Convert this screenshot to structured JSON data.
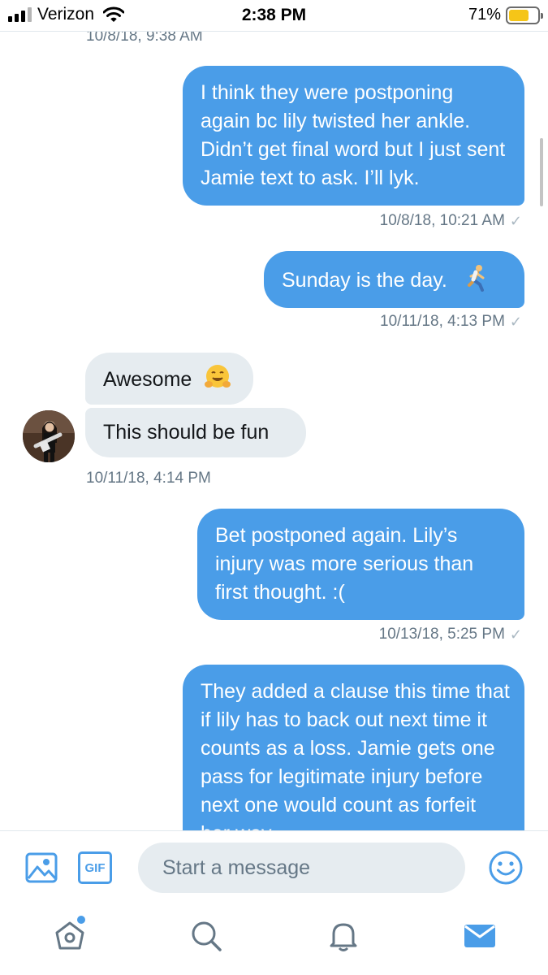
{
  "status_bar": {
    "carrier": "Verizon",
    "time": "2:38 PM",
    "battery_percent": "71%",
    "battery_level": 0.71,
    "battery_color": "#f5c518",
    "signal_bars": 3
  },
  "conversation": {
    "partial_timestamp": "10/8/18, 9:38 AM",
    "messages": [
      {
        "direction": "sent",
        "text": "I think they were postponing again bc lily twisted her ankle. Didn’t get final word but I just sent Jamie text to ask. I’ll lyk.",
        "timestamp": "10/8/18, 10:21 AM",
        "status_icon": "check-icon"
      },
      {
        "direction": "sent",
        "text": "Sunday is the day.",
        "emoji": "runner-emoji-icon",
        "timestamp": "10/11/18, 4:13 PM",
        "status_icon": "check-icon"
      },
      {
        "direction": "received",
        "text": "Awesome",
        "emoji": "hugging-face-emoji-icon"
      },
      {
        "direction": "received",
        "text": "This should be fun",
        "timestamp": "10/11/18, 4:14 PM"
      },
      {
        "direction": "sent",
        "text": "Bet postponed again. Lily’s injury was more serious than first thought. :(",
        "timestamp": "10/13/18, 5:25 PM",
        "status_icon": "check-icon"
      },
      {
        "direction": "sent",
        "text": "They added a clause this time that if lily has to back out next time it counts as a loss. Jamie gets one pass for legitimate injury before next one would count as forfeit her way."
      }
    ]
  },
  "composer": {
    "photo_icon": "photo-icon",
    "gif_label": "GIF",
    "placeholder": "Start a message",
    "emoji_icon": "smiley-icon"
  },
  "tab_bar": {
    "tabs": [
      "home-icon",
      "search-icon",
      "bell-icon",
      "mail-icon"
    ],
    "active_tab": "mail-icon",
    "unread_indicator": true
  },
  "colors": {
    "accent": "#4a9de8",
    "received_bubble": "#e6ecf0",
    "timestamp": "#657786",
    "check": "#aab8c2"
  }
}
